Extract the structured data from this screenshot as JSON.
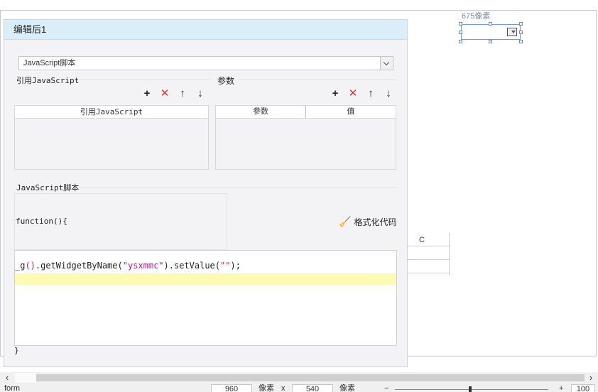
{
  "canvas": {
    "width_label": "675像素",
    "column_label": "C"
  },
  "dialog": {
    "title": "编辑后1",
    "type_select_value": "JavaScript脚本",
    "ref_js": {
      "title": "引用JavaScript",
      "columns": [
        "引用JavaScript"
      ]
    },
    "params": {
      "title": "参数",
      "columns": [
        "参数",
        "值"
      ]
    },
    "toolbar_icons": [
      "add-icon",
      "delete-icon",
      "arrow-up-icon",
      "arrow-down-icon"
    ],
    "script": {
      "title": "JavaScript脚本",
      "fn_open": "function(){",
      "format_label": "格式化代码",
      "code": {
        "prefix": "_g",
        "p1": "()",
        "mid": ".getWidgetByName(",
        "arg": "\"ysxmmc\"",
        "mid2": ").setValue(",
        "val": "\"\"",
        "end": ");"
      },
      "fn_close": "}"
    }
  },
  "statusbar": {
    "left_label": "form",
    "width_value": "960",
    "unit1": "像素",
    "times": "x",
    "height_value": "540",
    "unit2": "像素",
    "minus": "−",
    "plus": "+",
    "zoom": "100"
  }
}
